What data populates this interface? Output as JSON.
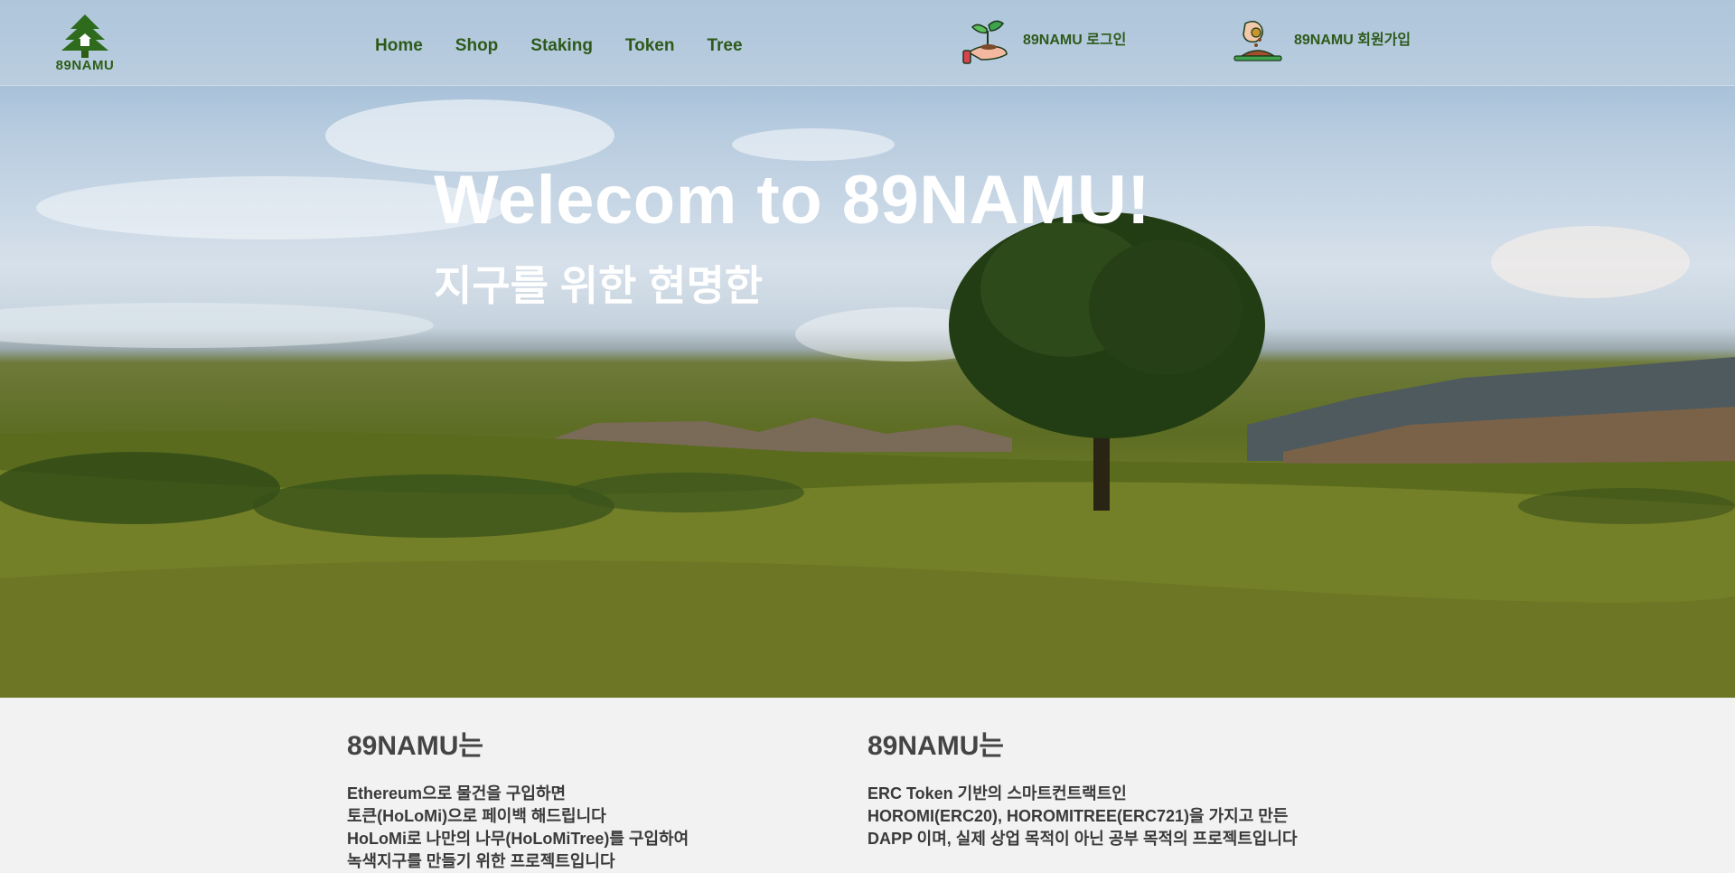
{
  "logo": {
    "text": "89NAMU",
    "icon": "tree-house-logo"
  },
  "nav": [
    {
      "label": "Home"
    },
    {
      "label": "Shop"
    },
    {
      "label": "Staking"
    },
    {
      "label": "Token"
    },
    {
      "label": "Tree"
    }
  ],
  "auth": {
    "login": {
      "label": "89NAMU 로그인",
      "icon": "hand-sprout-icon"
    },
    "signup": {
      "label": "89NAMU 회원가입",
      "icon": "hand-seed-icon"
    }
  },
  "hero": {
    "title": "Welecom to 89NAMU!",
    "subtitle": "지구를 위한 현명한"
  },
  "info_left": {
    "heading": "89NAMU는",
    "lines": [
      "Ethereum으로 물건을 구입하면",
      "토큰(HoLoMi)으로 페이백 해드립니다",
      "HoLoMi로 나만의 나무(HoLoMiTree)를 구입하여",
      "녹색지구를 만들기 위한 프로젝트입니다"
    ]
  },
  "info_right": {
    "heading": "89NAMU는",
    "lines": [
      "ERC Token 기반의 스마트컨트랙트인",
      "HOROMI(ERC20), HOROMITREE(ERC721)을 가지고 만든",
      "DAPP 이며, 실제 상업 목적이 아닌 공부 목적의 프로젝트입니다"
    ]
  },
  "colors": {
    "nav_text": "#2d5a1a",
    "heading": "#444444",
    "body_bg": "#f2f2f2"
  }
}
